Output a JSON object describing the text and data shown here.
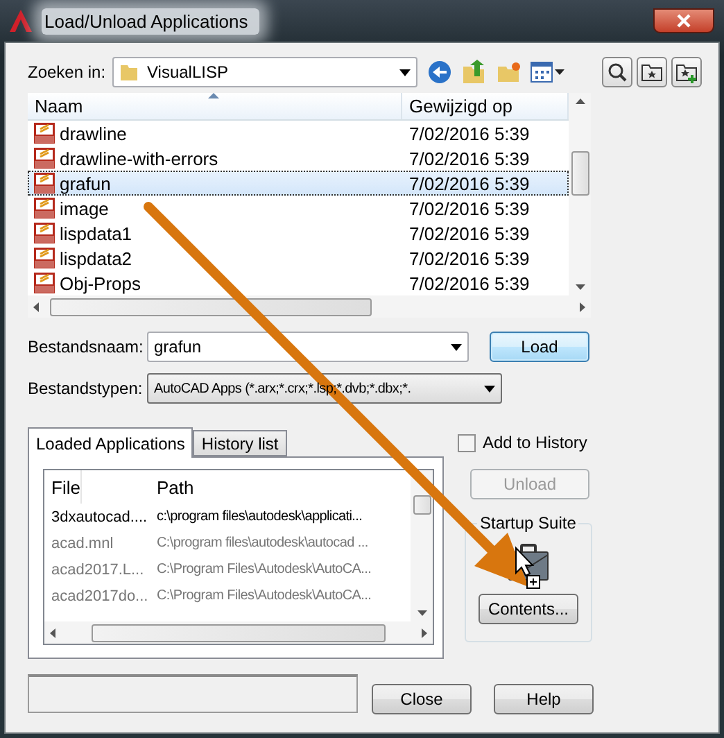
{
  "window": {
    "title": "Load/Unload Applications"
  },
  "look_in": {
    "label": "Zoeken in:",
    "value": "VisualLISP"
  },
  "file_list": {
    "columns": [
      "Naam",
      "Gewijzigd op"
    ],
    "rows": [
      {
        "name": "drawline",
        "modified": "7/02/2016 5:39",
        "selected": false
      },
      {
        "name": "drawline-with-errors",
        "modified": "7/02/2016 5:39",
        "selected": false
      },
      {
        "name": "grafun",
        "modified": "7/02/2016 5:39",
        "selected": true
      },
      {
        "name": "image",
        "modified": "7/02/2016 5:39",
        "selected": false
      },
      {
        "name": "lispdata1",
        "modified": "7/02/2016 5:39",
        "selected": false
      },
      {
        "name": "lispdata2",
        "modified": "7/02/2016 5:39",
        "selected": false
      },
      {
        "name": "Obj-Props",
        "modified": "7/02/2016 5:39",
        "selected": false
      }
    ]
  },
  "file_name": {
    "label": "Bestandsnaam:",
    "value": "grafun"
  },
  "file_types": {
    "label": "Bestandstypen:",
    "value": "AutoCAD Apps (*.arx;*.crx;*.lsp;*.dvb;*.dbx;*."
  },
  "load_button": "Load",
  "tabs": [
    {
      "label": "Loaded Applications",
      "selected": true
    },
    {
      "label": "History list",
      "selected": false
    }
  ],
  "loaded_list": {
    "columns": [
      "File",
      "Path"
    ],
    "rows": [
      {
        "file": "3dxautocad....",
        "path": "c:\\program files\\autodesk\\applicati...",
        "dimmed": false
      },
      {
        "file": "acad.mnl",
        "path": "C:\\program files\\autodesk\\autocad ...",
        "dimmed": true
      },
      {
        "file": "acad2017.L...",
        "path": "C:\\Program Files\\Autodesk\\AutoCA...",
        "dimmed": true
      },
      {
        "file": "acad2017do...",
        "path": "C:\\Program Files\\Autodesk\\AutoCA...",
        "dimmed": true
      }
    ]
  },
  "add_to_history": {
    "label": "Add to History",
    "checked": false
  },
  "unload_button": {
    "label": "Unload",
    "disabled": true
  },
  "startup_suite": {
    "title": "Startup Suite",
    "button": "Contents..."
  },
  "buttons": [
    "Close",
    "Help"
  ]
}
